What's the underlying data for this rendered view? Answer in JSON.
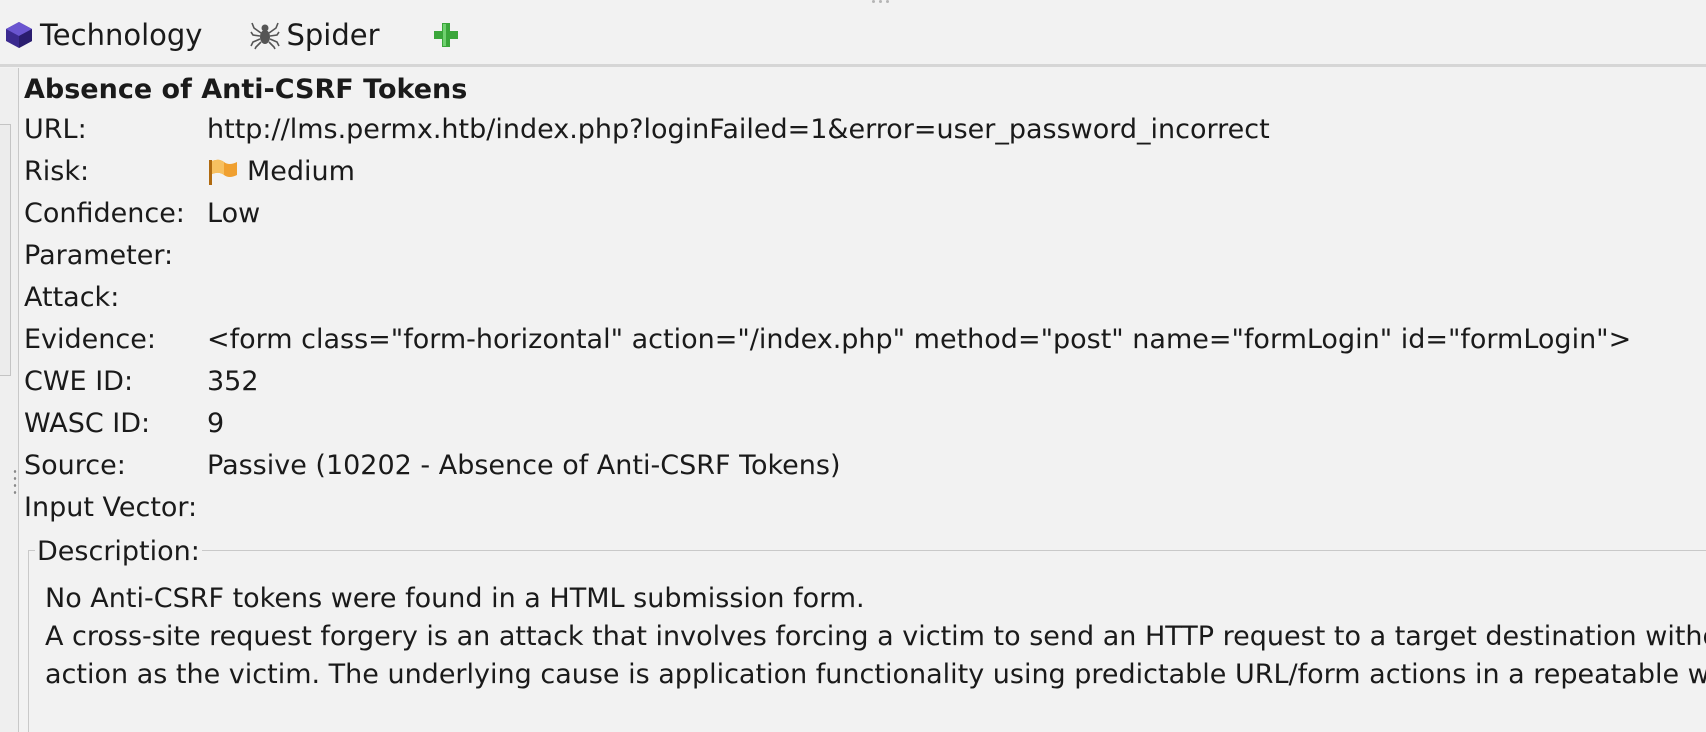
{
  "tabs": [
    {
      "label": "Technology",
      "icon": "technology-cube-icon",
      "color": "#3b2a8f"
    },
    {
      "label": "Spider",
      "icon": "spider-icon"
    },
    {
      "label": "",
      "icon": "add-plus-icon",
      "color": "#3aa63a"
    }
  ],
  "alert": {
    "title": "Absence of Anti-CSRF Tokens",
    "fields": [
      {
        "key": "URL:",
        "value": "http://lms.permx.htb/index.php?loginFailed=1&error=user_password_incorrect"
      },
      {
        "key": "Risk:",
        "value": "Medium",
        "icon": "risk-medium-flag-icon",
        "color": "#f0a030"
      },
      {
        "key": "Confidence:",
        "value": "Low"
      },
      {
        "key": "Parameter:",
        "value": ""
      },
      {
        "key": "Attack:",
        "value": ""
      },
      {
        "key": "Evidence:",
        "value": "<form class=\"form-horizontal\" action=\"/index.php\" method=\"post\" name=\"formLogin\" id=\"formLogin\">"
      },
      {
        "key": "CWE ID:",
        "value": "352"
      },
      {
        "key": "WASC ID:",
        "value": "9"
      },
      {
        "key": "Source:",
        "value": "Passive (10202 - Absence of Anti-CSRF Tokens)"
      },
      {
        "key": "Input Vector:",
        "value": ""
      }
    ],
    "description": {
      "legend": "Description:",
      "lines": [
        "No Anti-CSRF tokens were found in a HTML submission form.",
        "A cross-site request forgery is an attack that involves forcing a victim to send an HTTP request to a target destination without their knowledge or intent in order to perform an",
        "action as the victim. The underlying cause is application functionality using predictable URL/form actions in a repeatable way."
      ]
    }
  }
}
